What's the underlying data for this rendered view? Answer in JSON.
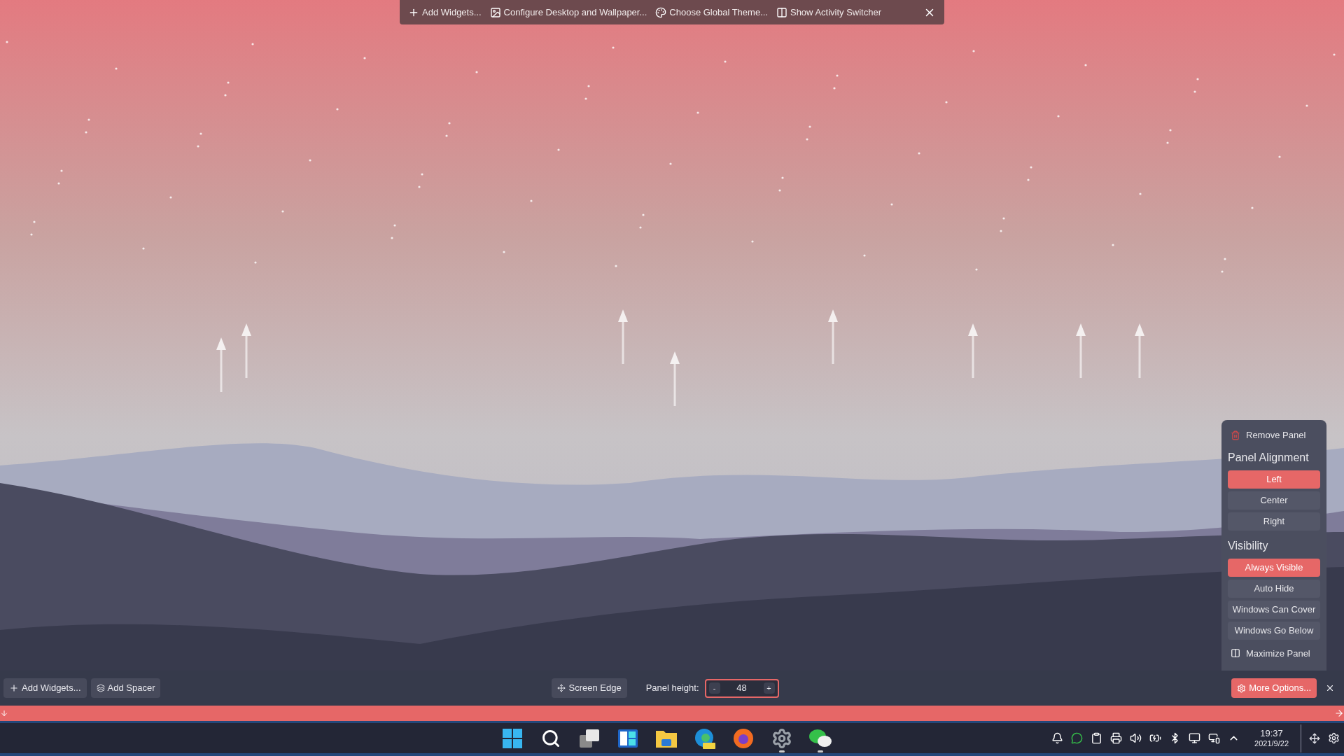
{
  "desktop_toolbar": {
    "items": [
      {
        "label": "Add Widgets..."
      },
      {
        "label": "Configure Desktop and Wallpaper..."
      },
      {
        "label": "Choose Global Theme..."
      },
      {
        "label": "Show Activity Switcher"
      }
    ]
  },
  "panel_menu": {
    "remove": "Remove Panel",
    "alignment": {
      "heading": "Panel Alignment",
      "options": [
        {
          "label": "Left",
          "selected": true
        },
        {
          "label": "Center",
          "selected": false
        },
        {
          "label": "Right",
          "selected": false
        }
      ]
    },
    "visibility": {
      "heading": "Visibility",
      "options": [
        {
          "label": "Always Visible",
          "selected": true
        },
        {
          "label": "Auto Hide",
          "selected": false
        },
        {
          "label": "Windows Can Cover",
          "selected": false
        },
        {
          "label": "Windows Go Below",
          "selected": false
        }
      ]
    },
    "maximize": "Maximize Panel"
  },
  "panel_bar": {
    "add_widgets": "Add Widgets...",
    "add_spacer": "Add Spacer",
    "screen_edge": "Screen Edge",
    "height_label": "Panel height:",
    "height_field": {
      "minus": "-",
      "value": "48",
      "plus": "+"
    },
    "more_options": "More Options..."
  },
  "taskbar": {
    "apps": [
      {
        "running": false
      },
      {
        "running": false
      },
      {
        "running": false
      },
      {
        "running": false
      },
      {
        "running": false
      },
      {
        "running": false
      },
      {
        "running": false
      },
      {
        "running": true
      },
      {
        "running": true
      }
    ],
    "clock": {
      "time": "19:37",
      "date": "2021/9/22"
    }
  }
}
